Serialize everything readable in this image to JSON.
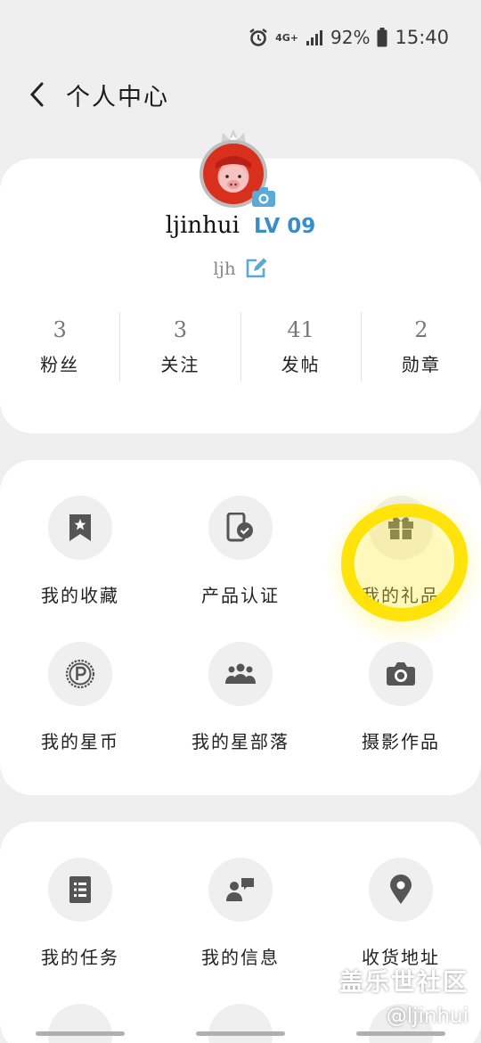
{
  "status": {
    "signal": "4G+",
    "battery": "92%",
    "time": "15:40"
  },
  "header": {
    "title": "个人中心"
  },
  "profile": {
    "username": "ljinhui",
    "level": "LV 09",
    "nickname": "ljh",
    "stats": [
      {
        "value": "3",
        "label": "粉丝"
      },
      {
        "value": "3",
        "label": "关注"
      },
      {
        "value": "41",
        "label": "发帖"
      },
      {
        "value": "2",
        "label": "勋章"
      }
    ]
  },
  "menu_section_1": [
    {
      "label": "我的收藏",
      "icon": "bookmark-star-icon"
    },
    {
      "label": "产品认证",
      "icon": "phone-verified-icon"
    },
    {
      "label": "我的礼品",
      "icon": "gift-icon"
    },
    {
      "label": "我的星币",
      "icon": "coin-icon"
    },
    {
      "label": "我的星部落",
      "icon": "group-icon"
    },
    {
      "label": "摄影作品",
      "icon": "camera-icon"
    }
  ],
  "menu_section_2": [
    {
      "label": "我的任务",
      "icon": "task-list-icon"
    },
    {
      "label": "我的信息",
      "icon": "message-icon"
    },
    {
      "label": "收货地址",
      "icon": "location-pin-icon"
    }
  ],
  "watermark": {
    "line1": "盖乐世社区",
    "line2": "@ljinhui"
  },
  "colors": {
    "accent": "#3b8dc7",
    "highlight": "#ffe200",
    "background": "#efefef",
    "icon": "#555555"
  }
}
